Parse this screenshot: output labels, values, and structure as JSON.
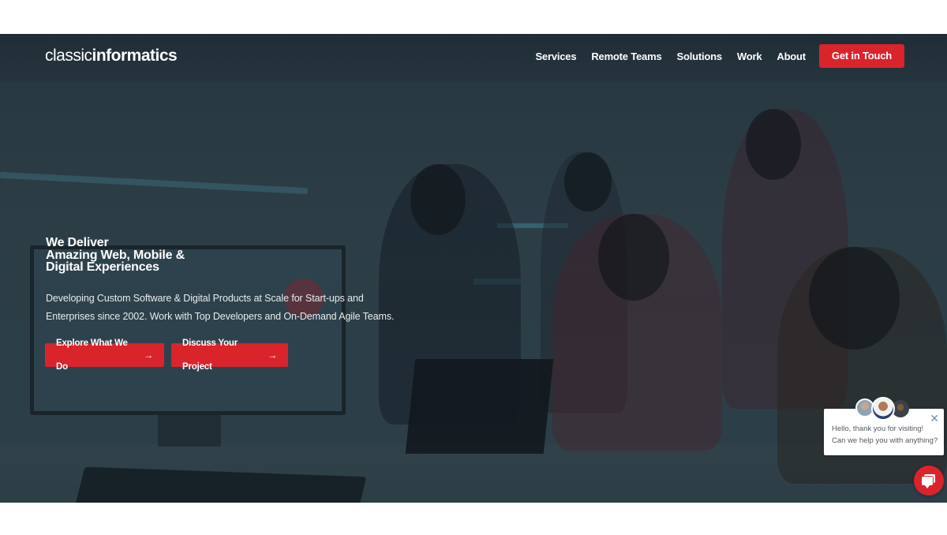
{
  "brand": {
    "logo_light": "classic",
    "logo_bold": "informatics",
    "accent_color": "#d9242c"
  },
  "nav": {
    "items": [
      {
        "label": "Services"
      },
      {
        "label": "Remote Teams"
      },
      {
        "label": "Solutions"
      },
      {
        "label": "Work"
      },
      {
        "label": "About"
      }
    ],
    "cta_label": "Get in Touch"
  },
  "hero": {
    "headline_lines": [
      "We Deliver",
      "Amazing Web, Mobile &",
      "Digital Experiences"
    ],
    "subtitle_line1": "Developing Custom Software & Digital Products at Scale for Start-ups and",
    "subtitle_line2": "Enterprises since 2002. Work with Top Developers and On-Demand Agile Teams.",
    "buttons": [
      {
        "label": "Explore What We Do",
        "icon": "arrow-right-icon",
        "glyph": "→"
      },
      {
        "label": "Discuss Your Project",
        "icon": "arrow-right-icon",
        "glyph": "→"
      }
    ]
  },
  "chat": {
    "message": "Hello, thank you for visiting! Can we help you with anything?",
    "close_glyph": "✕",
    "avatar_count": 3
  }
}
